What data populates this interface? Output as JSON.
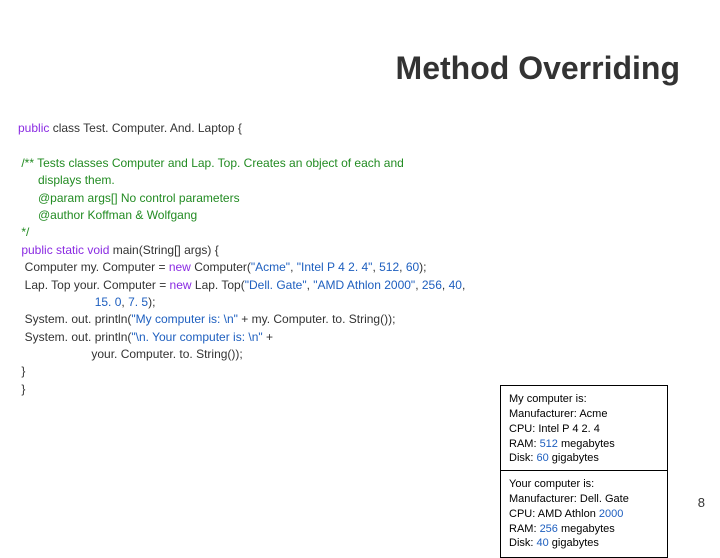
{
  "title": "Method Overriding",
  "code": {
    "l1a": "public ",
    "l1b": "class Test. Computer. And. Laptop {",
    "l2": " /** Tests classes Computer and Lap. Top. Creates an object of each and",
    "l3": "      displays them.",
    "l4": "      @param args[] No control parameters",
    "l5": "      @author Koffman & Wolfgang",
    "l6": " */",
    "l7a": " public static void ",
    "l7b": "main(String[] args) {",
    "l8a": "  Computer my. Computer = ",
    "l8b": "new ",
    "l8c": "Computer(",
    "l8d": "\"Acme\"",
    "l8e": ", ",
    "l8f": "\"Intel P 4 2. 4\"",
    "l8g": ", ",
    "l8h": "512",
    "l8i": ", ",
    "l8j": "60",
    "l8k": ");",
    "l9a": "  Lap. Top your. Computer = ",
    "l9b": "new ",
    "l9c": "Lap. Top(",
    "l9d": "\"Dell. Gate\"",
    "l9e": ", ",
    "l9f": "\"AMD Athlon 2000\"",
    "l9g": ", ",
    "l9h": "256",
    "l9i": ", ",
    "l9j": "40",
    "l9k": ",",
    "l10a": "                       ",
    "l10b": "15. 0",
    "l10c": ", ",
    "l10d": "7. 5",
    "l10e": ");",
    "l11a": "  System. out. println(",
    "l11b": "\"My computer is: \\n\" ",
    "l11c": "+ my. Computer. to. String());",
    "l12a": "  System. out. println(",
    "l12b": "\"\\n. Your computer is: \\n\" ",
    "l12c": "+",
    "l13": "                      your. Computer. to. String());",
    "l14": " }",
    "l15": " }"
  },
  "out1": {
    "a": "My computer is:",
    "b": "Manufacturer: Acme",
    "c": "CPU: Intel P 4 2. 4",
    "d1": "RAM: ",
    "d2": "512 ",
    "d3": "megabytes",
    "e1": "Disk: ",
    "e2": "60 ",
    "e3": "gigabytes"
  },
  "out2": {
    "a": "Your computer is:",
    "b": "Manufacturer: Dell. Gate",
    "c1": "CPU: AMD Athlon ",
    "c2": "2000",
    "d1": "RAM: ",
    "d2": "256 ",
    "d3": "megabytes",
    "e1": "Disk: ",
    "e2": "40 ",
    "e3": "gigabytes"
  },
  "page": "8"
}
